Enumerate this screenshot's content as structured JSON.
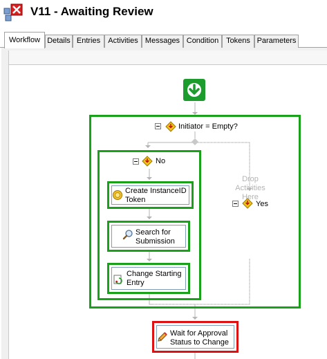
{
  "window": {
    "title": "V11 - Awaiting Review",
    "title_icon": "workflow-error-icon"
  },
  "tabs": [
    {
      "label": "Workflow",
      "active": true
    },
    {
      "label": "Details"
    },
    {
      "label": "Entries"
    },
    {
      "label": "Activities"
    },
    {
      "label": "Messages"
    },
    {
      "label": "Condition"
    },
    {
      "label": "Tokens"
    },
    {
      "label": "Parameters"
    }
  ],
  "workflow": {
    "start_icon": "start-arrow-icon",
    "condition": {
      "label": "Initiator = Empty?",
      "icon": "condition-diamond-icon"
    },
    "branch_no": {
      "label": "No",
      "activities": [
        {
          "label_line1": "Create InstanceID",
          "label_line2": "Token",
          "icon": "token-icon"
        },
        {
          "label_line1": "Search for",
          "label_line2": "Submission",
          "icon": "search-icon"
        },
        {
          "label_line1": "Change Starting",
          "label_line2": "Entry",
          "icon": "change-entry-icon"
        }
      ]
    },
    "branch_yes": {
      "label": "Yes",
      "drop_line1": "Drop",
      "drop_line2": "Activities",
      "drop_line3": "Here"
    },
    "wait_activity": {
      "label_line1": "Wait for Approval",
      "label_line2": "Status to Change",
      "icon": "pencil-icon"
    },
    "colors": {
      "selected": "#1aa11a",
      "error": "#dd1111",
      "start": "#1d9c2e"
    }
  }
}
